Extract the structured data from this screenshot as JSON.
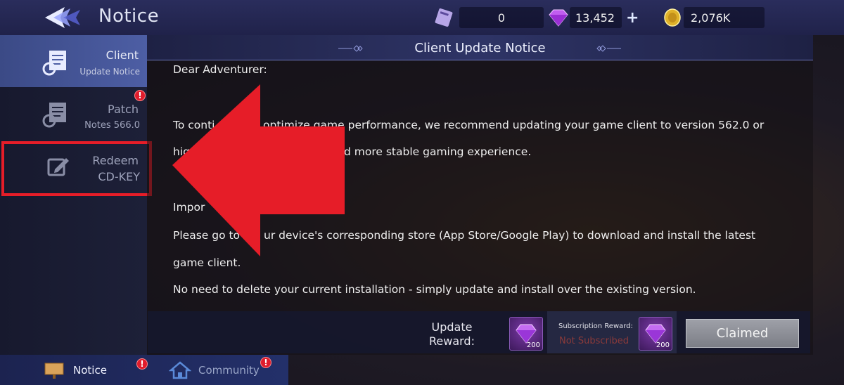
{
  "header": {
    "title": "Notice",
    "resources": {
      "tickets": "0",
      "diamonds": "13,452",
      "coins": "2,076K"
    }
  },
  "sidebar": {
    "items": [
      {
        "line1": "Client",
        "line2": "Update Notice",
        "active": true,
        "badge": ""
      },
      {
        "line1": "Patch",
        "line2": "Notes 566.0",
        "active": false,
        "badge": "!"
      },
      {
        "line1": "Redeem",
        "line2": "CD-KEY",
        "active": false,
        "badge": ""
      }
    ]
  },
  "panel": {
    "title": "Client Update Notice",
    "paragraphs": {
      "greeting": "Dear Adventurer:",
      "p1a": "To conti",
      "p1b": "optimize game performance, we recommend updating your game client to version 562.0 or",
      "p2a": "hig",
      "p2b": "d more stable gaming experience.",
      "important": "Impor",
      "p3a": "Please go to",
      "p3b": "ur device's corresponding store (App Store/Google Play) to download and install the latest",
      "p4": "game client.",
      "p5": "No need to delete your current installation - simply update and install over the existing version."
    }
  },
  "reward": {
    "label_line1": "Update",
    "label_line2": "Reward:",
    "gem_count": "200",
    "subscription_label": "Subscription Reward:",
    "subscription_status": "Not Subscribed",
    "subscription_gem_count": "200",
    "claim_button": "Claimed"
  },
  "bottom_nav": {
    "items": [
      {
        "label": "Notice",
        "badge": "!"
      },
      {
        "label": "Community",
        "badge": "!"
      }
    ]
  },
  "colors": {
    "highlight_red": "#e61d28",
    "active_tab": "#4d5ea4",
    "badge_red": "#e01c2c"
  }
}
